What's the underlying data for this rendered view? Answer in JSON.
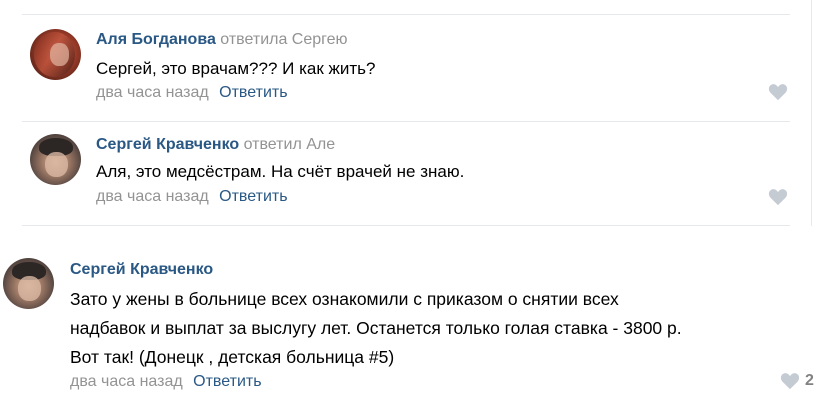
{
  "comments": [
    {
      "author": "Аля Богданова",
      "reply_to": "ответила Сергею",
      "text": "Сергей, это врачам??? И как жить?",
      "time": "два часа назад",
      "reply_label": "Ответить",
      "likes": "",
      "avatar_icon": "avatar-photo-woman"
    },
    {
      "author": "Сергей Кравченко",
      "reply_to": "ответил Але",
      "text": "Аля, это медсёстрам. На счёт врачей не знаю.",
      "time": "два часа назад",
      "reply_label": "Ответить",
      "likes": "",
      "avatar_icon": "avatar-photo-man"
    },
    {
      "author": "Сергей Кравченко",
      "reply_to": "",
      "text_lines": [
        "Зато у жены в больнице всех ознакомили с приказом о снятии всех",
        "надбавок и выплат за выслугу лет. Останется только голая ставка - 3800 р.",
        "Вот так! (Донецк , детская больница #5)"
      ],
      "time": "два часа назад",
      "reply_label": "Ответить",
      "likes": "2",
      "avatar_icon": "avatar-photo-man"
    }
  ],
  "colors": {
    "link": "#2a5885",
    "muted": "#939393",
    "heart": "#c5cbd3",
    "divider": "#e7e8ec"
  }
}
